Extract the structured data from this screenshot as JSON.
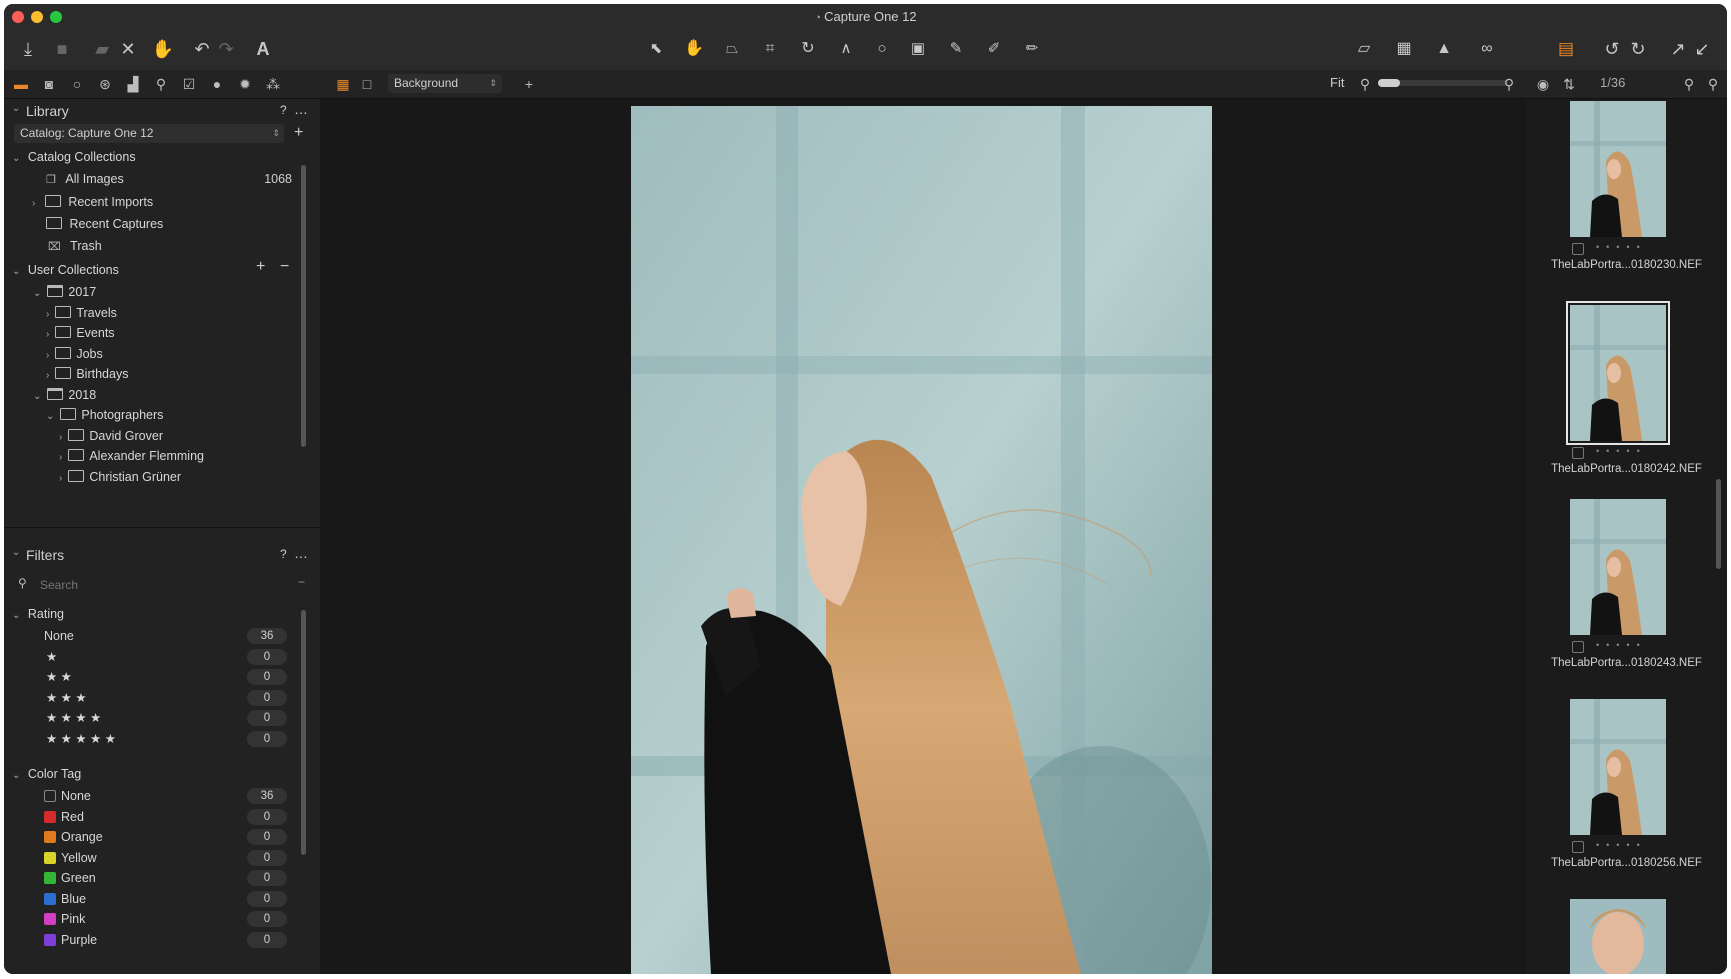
{
  "app": {
    "title": "Capture One 12",
    "title_icon": "capture-one-logo-icon"
  },
  "colors": {
    "accent": "#e8872b",
    "bg": "#181818",
    "panel": "#222222"
  },
  "toolbar": {
    "left_icons": [
      "import-icon",
      "camera-icon",
      "export-icon",
      "delete-icon",
      "undo-history-icon",
      "undo-icon",
      "redo-icon",
      "text-icon"
    ],
    "center_icons": [
      "select-cursor-icon",
      "pan-hand-icon",
      "keystone-icon",
      "crop-icon",
      "rotate-icon",
      "straighten-icon",
      "spot-icon",
      "mask-icon",
      "brush-icon",
      "erase-icon",
      "gradient-icon"
    ],
    "right_icons": [
      "compare-icon",
      "grid-icon",
      "warning-icon",
      "glasses-icon",
      "stack-icon",
      "rotate-left-icon",
      "rotate-right-icon",
      "expand-icon",
      "contract-icon"
    ]
  },
  "tabbar": {
    "tool_tabs": [
      "library-tab-icon",
      "capture-tab-icon",
      "lens-tab-icon",
      "color-tab-icon",
      "exposure-tab-icon",
      "details-tab-icon",
      "adjustments-tab-icon",
      "metadata-tab-icon",
      "output-tab-icon",
      "batch-tab-icon"
    ],
    "layer": "Background",
    "zoom": "Fit",
    "page": "1/36"
  },
  "library": {
    "header": "Library",
    "help": "?",
    "more": "…",
    "catalog": "Catalog: Capture One 12",
    "catalog_collections": {
      "label": "Catalog Collections",
      "items": [
        {
          "label": "All Images",
          "count": "1068"
        },
        {
          "label": "Recent Imports",
          "count": ""
        },
        {
          "label": "Recent Captures",
          "count": ""
        },
        {
          "label": "Trash",
          "count": ""
        }
      ]
    },
    "user_collections": {
      "label": "User Collections",
      "tree": [
        {
          "label": "2017",
          "depth": 1,
          "open": true,
          "type": "project"
        },
        {
          "label": "Travels",
          "depth": 2,
          "open": false,
          "type": "folder"
        },
        {
          "label": "Events",
          "depth": 2,
          "open": false,
          "type": "folder"
        },
        {
          "label": "Jobs",
          "depth": 2,
          "open": false,
          "type": "folder"
        },
        {
          "label": "Birthdays",
          "depth": 2,
          "open": false,
          "type": "folder"
        },
        {
          "label": "2018",
          "depth": 1,
          "open": true,
          "type": "project"
        },
        {
          "label": "Photographers",
          "depth": 2,
          "open": true,
          "type": "folder"
        },
        {
          "label": "David Grover",
          "depth": 3,
          "open": false,
          "type": "folder"
        },
        {
          "label": "Alexander Flemming",
          "depth": 3,
          "open": false,
          "type": "folder"
        },
        {
          "label": "Christian Grüner",
          "depth": 3,
          "open": false,
          "type": "folder"
        }
      ]
    }
  },
  "filters": {
    "header": "Filters",
    "help": "?",
    "more": "…",
    "search_placeholder": "Search",
    "rating": {
      "label": "Rating",
      "rows": [
        {
          "label": "None",
          "count": "36"
        },
        {
          "label": "★",
          "count": "0"
        },
        {
          "label": "★ ★",
          "count": "0"
        },
        {
          "label": "★ ★ ★",
          "count": "0"
        },
        {
          "label": "★ ★ ★ ★",
          "count": "0"
        },
        {
          "label": "★ ★ ★ ★ ★",
          "count": "0"
        }
      ]
    },
    "color_tag": {
      "label": "Color Tag",
      "rows": [
        {
          "label": "None",
          "count": "36",
          "color": ""
        },
        {
          "label": "Red",
          "count": "0",
          "color": "#d42b2b"
        },
        {
          "label": "Orange",
          "count": "0",
          "color": "#e07a21"
        },
        {
          "label": "Yellow",
          "count": "0",
          "color": "#d9d429"
        },
        {
          "label": "Green",
          "count": "0",
          "color": "#34b537"
        },
        {
          "label": "Blue",
          "count": "0",
          "color": "#2b6fd1"
        },
        {
          "label": "Pink",
          "count": "0",
          "color": "#d23fc4"
        },
        {
          "label": "Purple",
          "count": "0",
          "color": "#7d3fd6"
        }
      ]
    }
  },
  "browser": {
    "thumbnails": [
      {
        "name": "TheLabPortra...0180230.NEF",
        "selected": false
      },
      {
        "name": "TheLabPortra...0180242.NEF",
        "selected": true
      },
      {
        "name": "TheLabPortra...0180243.NEF",
        "selected": false
      },
      {
        "name": "TheLabPortra...0180256.NEF",
        "selected": false
      }
    ]
  }
}
